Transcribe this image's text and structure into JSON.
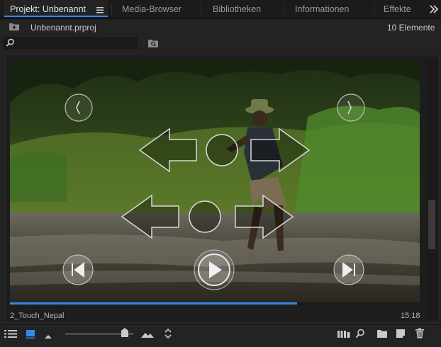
{
  "tabs": [
    {
      "label": "Projekt: Unbenannt",
      "active": true
    },
    {
      "label": "Media-Browser",
      "active": false
    },
    {
      "label": "Bibliotheken",
      "active": false
    },
    {
      "label": "Informationen",
      "active": false
    },
    {
      "label": "Effekte",
      "active": false
    }
  ],
  "project": {
    "filename": "Unbenannt.prproj",
    "item_count": "10 Elemente"
  },
  "search": {
    "value": ""
  },
  "clip": {
    "name": "2_Touch_Nepal",
    "duration": "15:18",
    "playhead": 0.7
  },
  "toolbar": {
    "zoom_level": 0.88
  },
  "colors": {
    "accent": "#2d8ceb",
    "background": "#232323",
    "tabbar": "#1b1b1b"
  },
  "icons": {
    "panel_menu": "hamburger-icon",
    "overflow": "double-chevron-right-icon",
    "folder_up": "folder-up-icon",
    "search": "search-icon",
    "bin_search": "bin-search-icon",
    "list_view": "list-view-icon",
    "icon_view": "icon-view-icon",
    "freeform_view": "freeform-view-icon",
    "sort": "sort-icon",
    "automate": "automate-sequence-icon",
    "find": "find-icon",
    "new_bin": "new-bin-icon",
    "new_item": "new-item-icon",
    "trash": "trash-icon"
  }
}
